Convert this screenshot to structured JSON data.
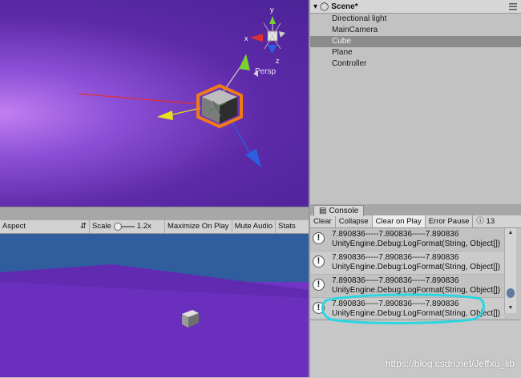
{
  "scene_view": {
    "persp_label": "Persp",
    "gizmo_axes": {
      "y": "y",
      "x": "x",
      "z": "z"
    }
  },
  "game_toolbar": {
    "aspect": "Aspect",
    "scale_label": "Scale",
    "scale_value": "1.2x",
    "maximize": "Maximize On Play",
    "mute": "Mute Audio",
    "stats": "Stats"
  },
  "hierarchy": {
    "scene_name": "Scene*",
    "items": [
      {
        "label": "Directional light",
        "selected": false
      },
      {
        "label": "MainCamera",
        "selected": false
      },
      {
        "label": "Cube",
        "selected": true
      },
      {
        "label": "Plane",
        "selected": false
      },
      {
        "label": "Controller",
        "selected": false
      }
    ]
  },
  "console": {
    "tab_label": "Console",
    "toolbar": {
      "clear": "Clear",
      "collapse": "Collapse",
      "clear_on_play": "Clear on Play",
      "error_pause": "Error Pause",
      "info_count": "13"
    },
    "logs": [
      {
        "line1": "7.890836-----7.890836-----7.890836",
        "line2": "UnityEngine.Debug:LogFormat(String, Object[])"
      },
      {
        "line1": "7.890836-----7.890836-----7.890836",
        "line2": "UnityEngine.Debug:LogFormat(String, Object[])"
      },
      {
        "line1": "7.890836-----7.890836-----7.890836",
        "line2": "UnityEngine.Debug:LogFormat(String, Object[])"
      },
      {
        "line1": "7.890836-----7.890836-----7.890836",
        "line2": "UnityEngine.Debug:LogFormat(String, Object[])"
      }
    ]
  },
  "watermark": "https://blog.csdn.net/Jeffxu_lib",
  "colors": {
    "highlight_ring": "#2ad6e0",
    "selection": "#8c8c8c",
    "cube_outline": "#f07a1a",
    "axis_x": "#e03030",
    "axis_y": "#7ad030",
    "axis_z": "#2a60e0",
    "axis_yellow": "#e8e020"
  }
}
